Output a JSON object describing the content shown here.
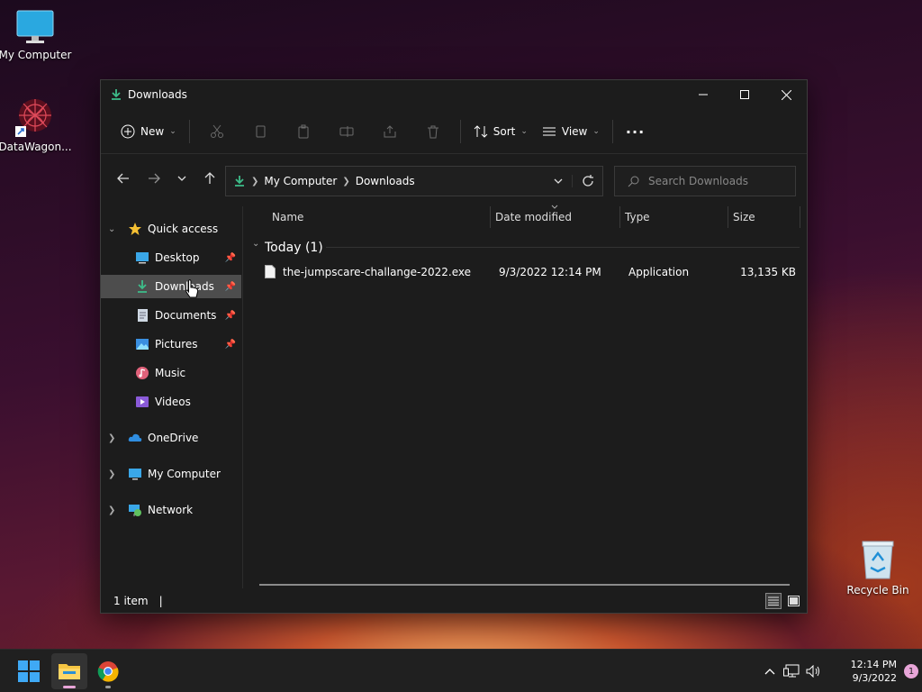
{
  "desktop": {
    "my_computer_label": "My Computer",
    "datawagon_label": "DataWagon...",
    "recycle_bin_label": "Recycle Bin"
  },
  "window": {
    "title": "Downloads",
    "accent": "#3dbd8a"
  },
  "toolbar": {
    "new_label": "New",
    "sort_label": "Sort",
    "view_label": "View",
    "more_label": "..."
  },
  "address": {
    "crumbs": [
      "My Computer",
      "Downloads"
    ]
  },
  "search": {
    "placeholder": "Search Downloads"
  },
  "sidebar": {
    "quick_access": "Quick access",
    "items": [
      {
        "label": "Desktop",
        "icon": "desktop-icon",
        "pinned": true
      },
      {
        "label": "Downloads",
        "icon": "download-icon",
        "pinned": true,
        "selected": true
      },
      {
        "label": "Documents",
        "icon": "document-icon",
        "pinned": true
      },
      {
        "label": "Pictures",
        "icon": "pictures-icon",
        "pinned": true
      },
      {
        "label": "Music",
        "icon": "music-icon",
        "pinned": false
      },
      {
        "label": "Videos",
        "icon": "videos-icon",
        "pinned": false
      }
    ],
    "onedrive": "OneDrive",
    "my_computer": "My Computer",
    "network": "Network"
  },
  "columns": {
    "name": "Name",
    "date": "Date modified",
    "type": "Type",
    "size": "Size"
  },
  "group": {
    "label": "Today (1)"
  },
  "files": [
    {
      "name": "the-jumpscare-challange-2022.exe",
      "date": "9/3/2022 12:14 PM",
      "type": "Application",
      "size": "13,135 KB"
    }
  ],
  "status": {
    "count": "1 item",
    "sep": "|"
  },
  "taskbar": {
    "time": "12:14 PM",
    "date": "9/3/2022",
    "notifications": "1"
  }
}
